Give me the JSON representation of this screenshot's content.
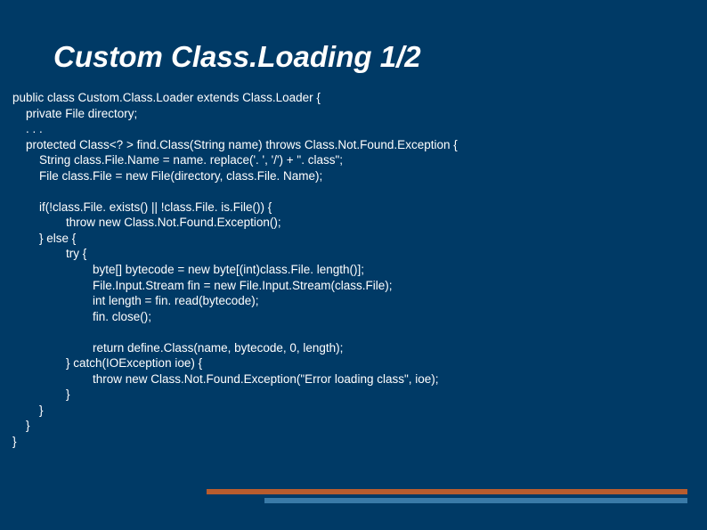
{
  "title": "Custom Class.Loading 1/2",
  "code": "public class Custom.Class.Loader extends Class.Loader {\n    private File directory;\n    . . .\n    protected Class<? > find.Class(String name) throws Class.Not.Found.Exception {\n        String class.File.Name = name. replace('. ', '/') + \". class\";\n        File class.File = new File(directory, class.File. Name);\n\n        if(!class.File. exists() || !class.File. is.File()) {\n                throw new Class.Not.Found.Exception();\n        } else {\n                try {\n                        byte[] bytecode = new byte[(int)class.File. length()];\n                        File.Input.Stream fin = new File.Input.Stream(class.File);\n                        int length = fin. read(bytecode);\n                        fin. close();\n\n                        return define.Class(name, bytecode, 0, length);\n                } catch(IOException ioe) {\n                        throw new Class.Not.Found.Exception(\"Error loading class\", ioe);\n                }\n        }\n    }\n}"
}
